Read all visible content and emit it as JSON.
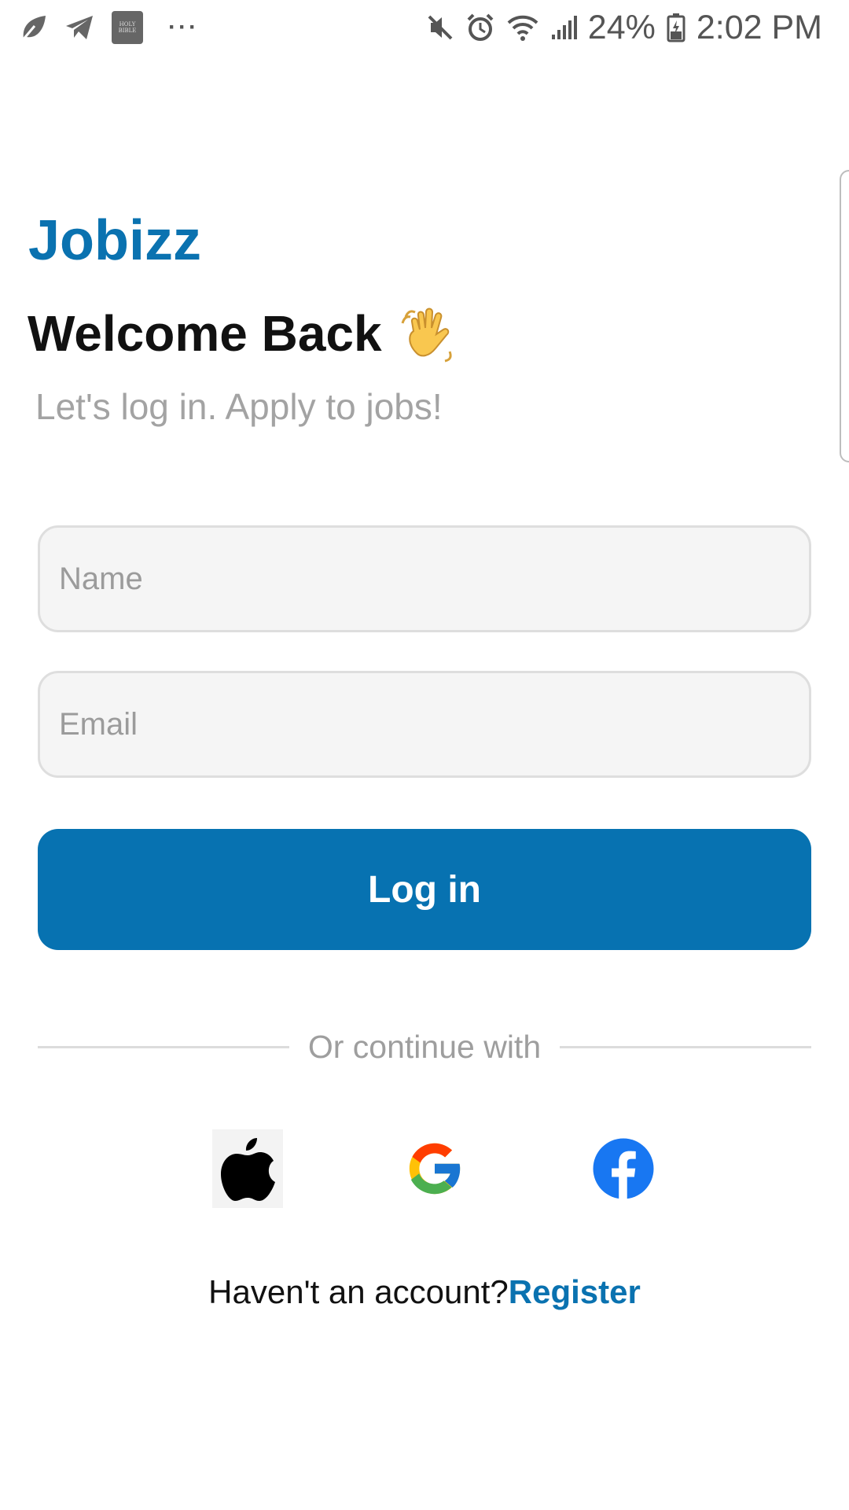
{
  "status_bar": {
    "left_icons": [
      "leaf-icon",
      "telegram-icon",
      "bible-app-icon",
      "more-notifications-icon"
    ],
    "bible_icon_text": [
      "HOLY",
      "BIBLE"
    ],
    "more_dots": "···",
    "right_icons": [
      "mute-icon",
      "alarm-icon",
      "wifi-icon",
      "signal-icon",
      "battery-icon"
    ],
    "battery": "24%",
    "time": "2:02 PM"
  },
  "header": {
    "brand": "Jobizz",
    "welcome": "Welcome Back",
    "welcome_icon": "waving-hand-icon",
    "subtitle": "Let's log in. Apply to jobs!"
  },
  "form": {
    "name_placeholder": "Name",
    "name_value": "",
    "email_placeholder": "Email",
    "email_value": "",
    "login_label": "Log in"
  },
  "divider": {
    "text": "Or continue with"
  },
  "social": [
    "apple-icon",
    "google-icon",
    "facebook-icon"
  ],
  "register": {
    "prefix": "Haven't an account?",
    "link": "Register"
  },
  "colors": {
    "brand": "#0a72b0",
    "button": "#0772b1",
    "muted_text": "#a3a3a3",
    "field_bg": "#f5f5f5",
    "field_border": "#dedede"
  }
}
